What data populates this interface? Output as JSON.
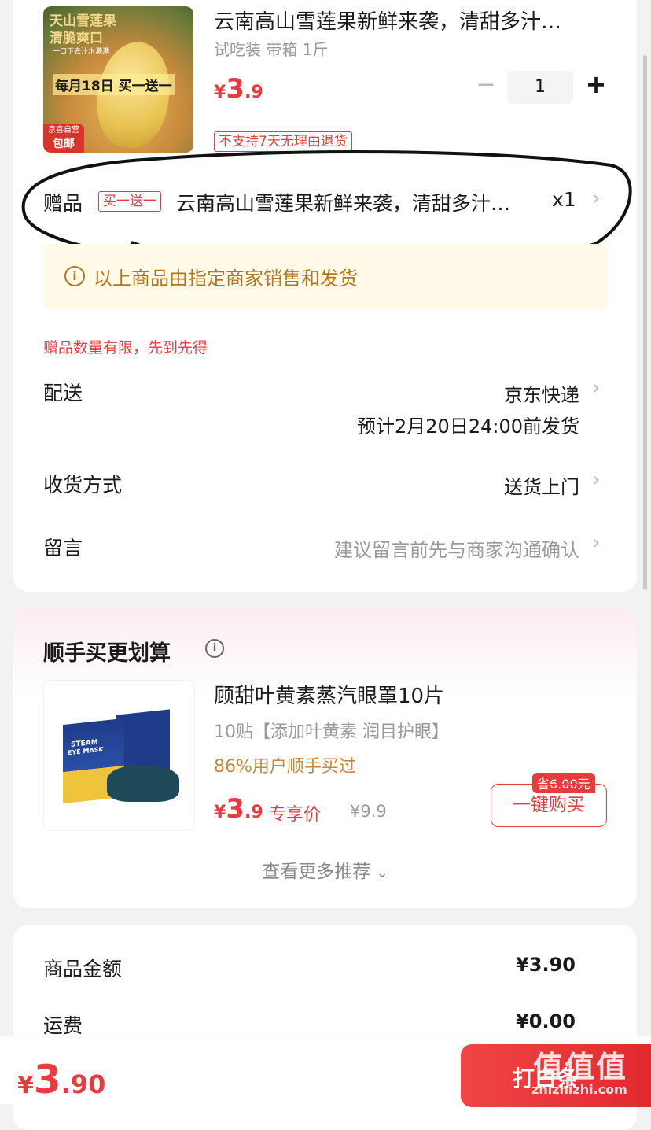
{
  "product": {
    "thumb": {
      "line1": "天山雪莲果",
      "line2": "清脆爽口",
      "small": "一口下去汁水满满",
      "banner": "每月18日 买一送一",
      "badge1": "京喜自营",
      "badge2": "包邮"
    },
    "title": "云南高山雪莲果新鲜来袭，清甜多汁…",
    "spec": "试吃装 带箱 1斤",
    "price_symbol": "¥",
    "price_int": "3",
    "price_dec": ".9",
    "quantity": "1",
    "minus": "−",
    "plus": "+",
    "return_tag": "不支持7天无理由退货"
  },
  "gift": {
    "label": "赠品",
    "tag": "买一送一",
    "name": "云南高山雪莲果新鲜来袭，清甜多汁…",
    "qty": "x1"
  },
  "notice": {
    "icon": "info-icon",
    "text": "以上商品由指定商家销售和发货"
  },
  "gift_limit": "赠品数量有限，先到先得",
  "delivery": {
    "label": "配送",
    "value": "京东快递",
    "eta": "预计2月20日24:00前发货"
  },
  "receive": {
    "label": "收货方式",
    "value": "送货上门"
  },
  "message": {
    "label": "留言",
    "placeholder": "建议留言前先与商家沟通确认"
  },
  "recommend": {
    "title": "顺手买更划算",
    "item": {
      "title": "顾甜叶黄素蒸汽眼罩10片",
      "desc": "10贴【添加叶黄素 润目护眼】",
      "social": "86%用户顺手买过",
      "price_symbol": "¥",
      "price_int": "3",
      "price_dec": ".9",
      "exclusive": "专享价",
      "original": "¥9.9",
      "save_tag": "省6.00元",
      "buy_button": "一键购买",
      "box_text1": "STEAM",
      "box_text2": "EYE MASK"
    },
    "more": "查看更多推荐"
  },
  "summary": {
    "goods_label": "商品金额",
    "goods_value": "¥3.90",
    "shipping_label": "运费",
    "shipping_value": "¥0.00"
  },
  "bottom": {
    "total_symbol": "¥",
    "total_int": "3",
    "total_dec": ".90",
    "pay_button": "打白条"
  },
  "watermark": {
    "mark": "值值值",
    "site": "zhizhizhi.com"
  },
  "colors": {
    "accent": "#e93b3d",
    "notice_bg": "#fffbe8",
    "notice_text": "#b8741a",
    "social": "#c9873a"
  }
}
